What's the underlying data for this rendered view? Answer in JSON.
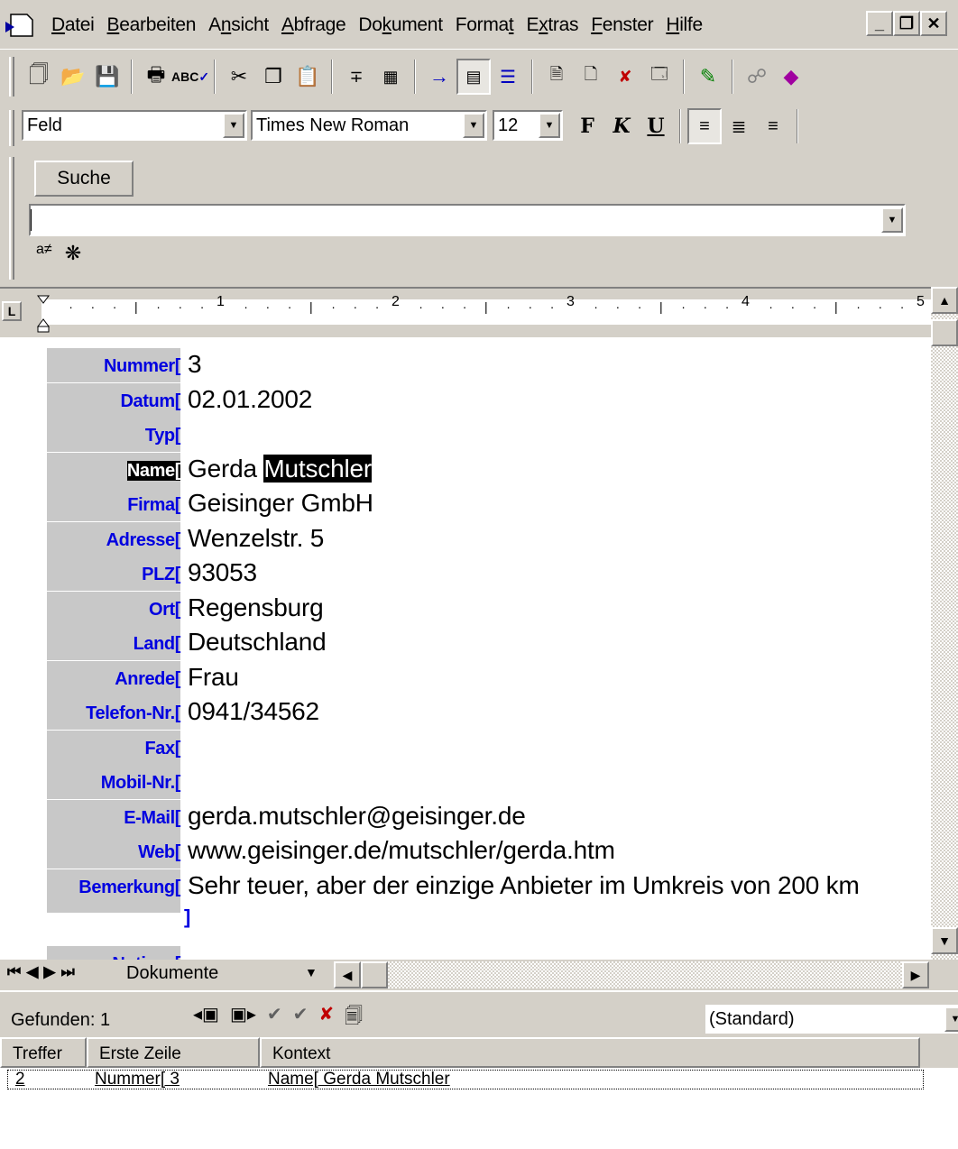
{
  "menubar": {
    "items": [
      {
        "label": "Datei",
        "accel": "D"
      },
      {
        "label": "Bearbeiten",
        "accel": "B"
      },
      {
        "label": "Ansicht",
        "accel": "n"
      },
      {
        "label": "Abfrage",
        "accel": "A"
      },
      {
        "label": "Dokument",
        "accel": "k"
      },
      {
        "label": "Format",
        "accel": "t"
      },
      {
        "label": "Extras",
        "accel": "x"
      },
      {
        "label": "Fenster",
        "accel": "F"
      },
      {
        "label": "Hilfe",
        "accel": "H"
      }
    ]
  },
  "format_toolbar": {
    "style_value": "Feld",
    "font_value": "Times New Roman",
    "size_value": "12",
    "bold_label": "F",
    "italic_label": "K",
    "underline_label": "U"
  },
  "search": {
    "button_label": "Suche",
    "input_value": ""
  },
  "ruler": {
    "numbers": [
      "1",
      "2",
      "3",
      "4",
      "5"
    ]
  },
  "record": {
    "fields": [
      {
        "name": "Nummer[",
        "value": "3"
      },
      {
        "name": "Datum[",
        "value": "02.01.2002"
      },
      {
        "name": "Typ[",
        "value": ""
      },
      {
        "name": "Name[",
        "value": "Gerda ",
        "highlight": "Mutschler"
      },
      {
        "name": "Firma[",
        "value": "Geisinger GmbH"
      },
      {
        "name": "Adresse[",
        "value": "Wenzelstr. 5"
      },
      {
        "name": "PLZ[",
        "value": "93053"
      },
      {
        "name": "Ort[",
        "value": "Regensburg"
      },
      {
        "name": "Land[",
        "value": "Deutschland"
      },
      {
        "name": "Anrede[",
        "value": "Frau"
      },
      {
        "name": "Telefon-Nr.[",
        "value": "0941/34562"
      },
      {
        "name": "Fax[",
        "value": ""
      },
      {
        "name": "Mobil-Nr.[",
        "value": ""
      },
      {
        "name": "E-Mail[",
        "value": "gerda.mutschler@geisinger.de"
      },
      {
        "name": "Web[",
        "value": "www.geisinger.de/mutschler/gerda.htm"
      },
      {
        "name": "Bemerkung[",
        "value": "Sehr teuer, aber der einzige Anbieter im Umkreis von 200 km"
      }
    ],
    "closing_bracket": "]",
    "notes_label": "Notizen["
  },
  "docnav": {
    "label": "Dokumente"
  },
  "results": {
    "found_label": "Gefunden: 1",
    "style_value": "(Standard)",
    "columns": [
      "Treffer",
      "Erste Zeile",
      "Kontext"
    ],
    "rows": [
      {
        "hit": "2",
        "first_line": "Nummer[ 3",
        "context": "Name[ Gerda Mutschler"
      }
    ]
  }
}
